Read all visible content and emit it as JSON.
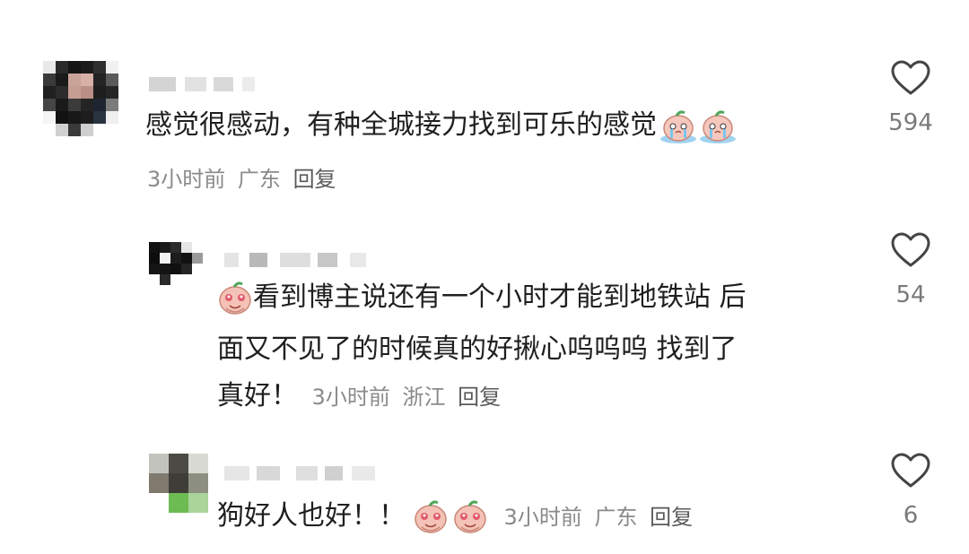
{
  "comments": [
    {
      "text": "感觉很感动，有种全城接力找到可乐的感觉",
      "meta": {
        "time": "3小时前",
        "location": "广东",
        "reply": "回复"
      },
      "likes": "594",
      "emoji": [
        "crying-peach-emoji",
        "crying-peach-emoji"
      ]
    },
    {
      "text_line1": "看到博主说还有一个小时才能到地铁站 后",
      "text_line2": "面又不见了的时候真的好揪心呜呜呜 找到了",
      "text_line3": "真好！",
      "meta": {
        "time": "3小时前",
        "location": "浙江",
        "reply": "回复"
      },
      "likes": "54",
      "emoji": [
        "touched-peach-emoji"
      ]
    },
    {
      "text": "狗好人也好！！",
      "meta": {
        "time": "3小时前",
        "location": "广东",
        "reply": "回复"
      },
      "likes": "6",
      "emoji": [
        "touched-peach-emoji",
        "touched-peach-emoji"
      ]
    }
  ],
  "icons": {
    "like": "heart-outline-icon"
  },
  "colors": {
    "text": "#1f1f1f",
    "meta": "#8a8a8a",
    "heart": "#444444"
  }
}
